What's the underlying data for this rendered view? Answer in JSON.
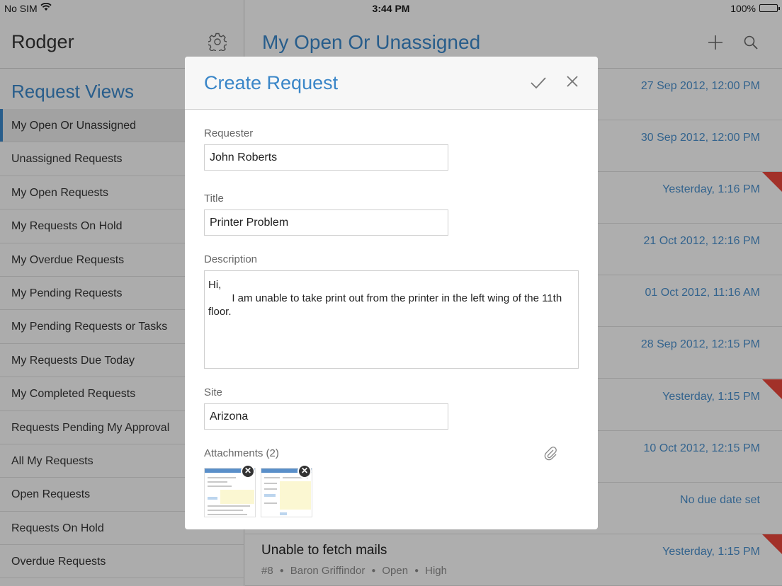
{
  "status_bar": {
    "carrier": "No SIM",
    "time": "3:44 PM",
    "battery": "100%"
  },
  "sidebar": {
    "app_title": "Rodger",
    "section_title": "Request Views",
    "items": [
      {
        "label": "My Open Or Unassigned"
      },
      {
        "label": "Unassigned Requests"
      },
      {
        "label": "My Open Requests"
      },
      {
        "label": "My Requests On Hold"
      },
      {
        "label": "My Overdue Requests"
      },
      {
        "label": "My Pending Requests"
      },
      {
        "label": "My Pending Requests or Tasks"
      },
      {
        "label": "My Requests Due Today"
      },
      {
        "label": "My Completed Requests"
      },
      {
        "label": "Requests Pending My Approval"
      },
      {
        "label": "All My Requests"
      },
      {
        "label": "Open Requests"
      },
      {
        "label": "Requests On Hold"
      },
      {
        "label": "Overdue Requests"
      }
    ]
  },
  "main": {
    "title": "My Open Or Unassigned",
    "rows": [
      {
        "date": "27 Sep 2012, 12:00 PM"
      },
      {
        "date": "30 Sep 2012, 12:00 PM"
      },
      {
        "date": "Yesterday, 1:16 PM"
      },
      {
        "date": "21 Oct 2012, 12:16 PM"
      },
      {
        "date": "01 Oct 2012, 11:16 AM"
      },
      {
        "date": "28 Sep 2012, 12:15 PM"
      },
      {
        "date": "Yesterday, 1:15 PM"
      },
      {
        "date": "10 Oct 2012, 12:15 PM"
      },
      {
        "date": "No due date set"
      },
      {
        "date": "Yesterday, 1:15 PM",
        "title": "Unable to fetch mails",
        "id": "#8",
        "requester": "Baron Griffindor",
        "status": "Open",
        "priority": "High"
      }
    ]
  },
  "modal": {
    "title": "Create Request",
    "requester_label": "Requester",
    "requester_value": "John Roberts",
    "title_label": "Title",
    "title_value": "Printer Problem",
    "description_label": "Description",
    "description_value": "Hi,\n        I am unable to take print out from the printer in the left wing of the 11th floor.",
    "site_label": "Site",
    "site_value": "Arizona",
    "attachments_label": "Attachments (2)"
  },
  "colors": {
    "accent": "#3a86c8",
    "flag": "#e8473c"
  },
  "icons": [
    "wifi-icon",
    "gear-icon",
    "plus-icon",
    "search-icon",
    "check-icon",
    "close-icon",
    "paperclip-icon",
    "flag-icon"
  ]
}
